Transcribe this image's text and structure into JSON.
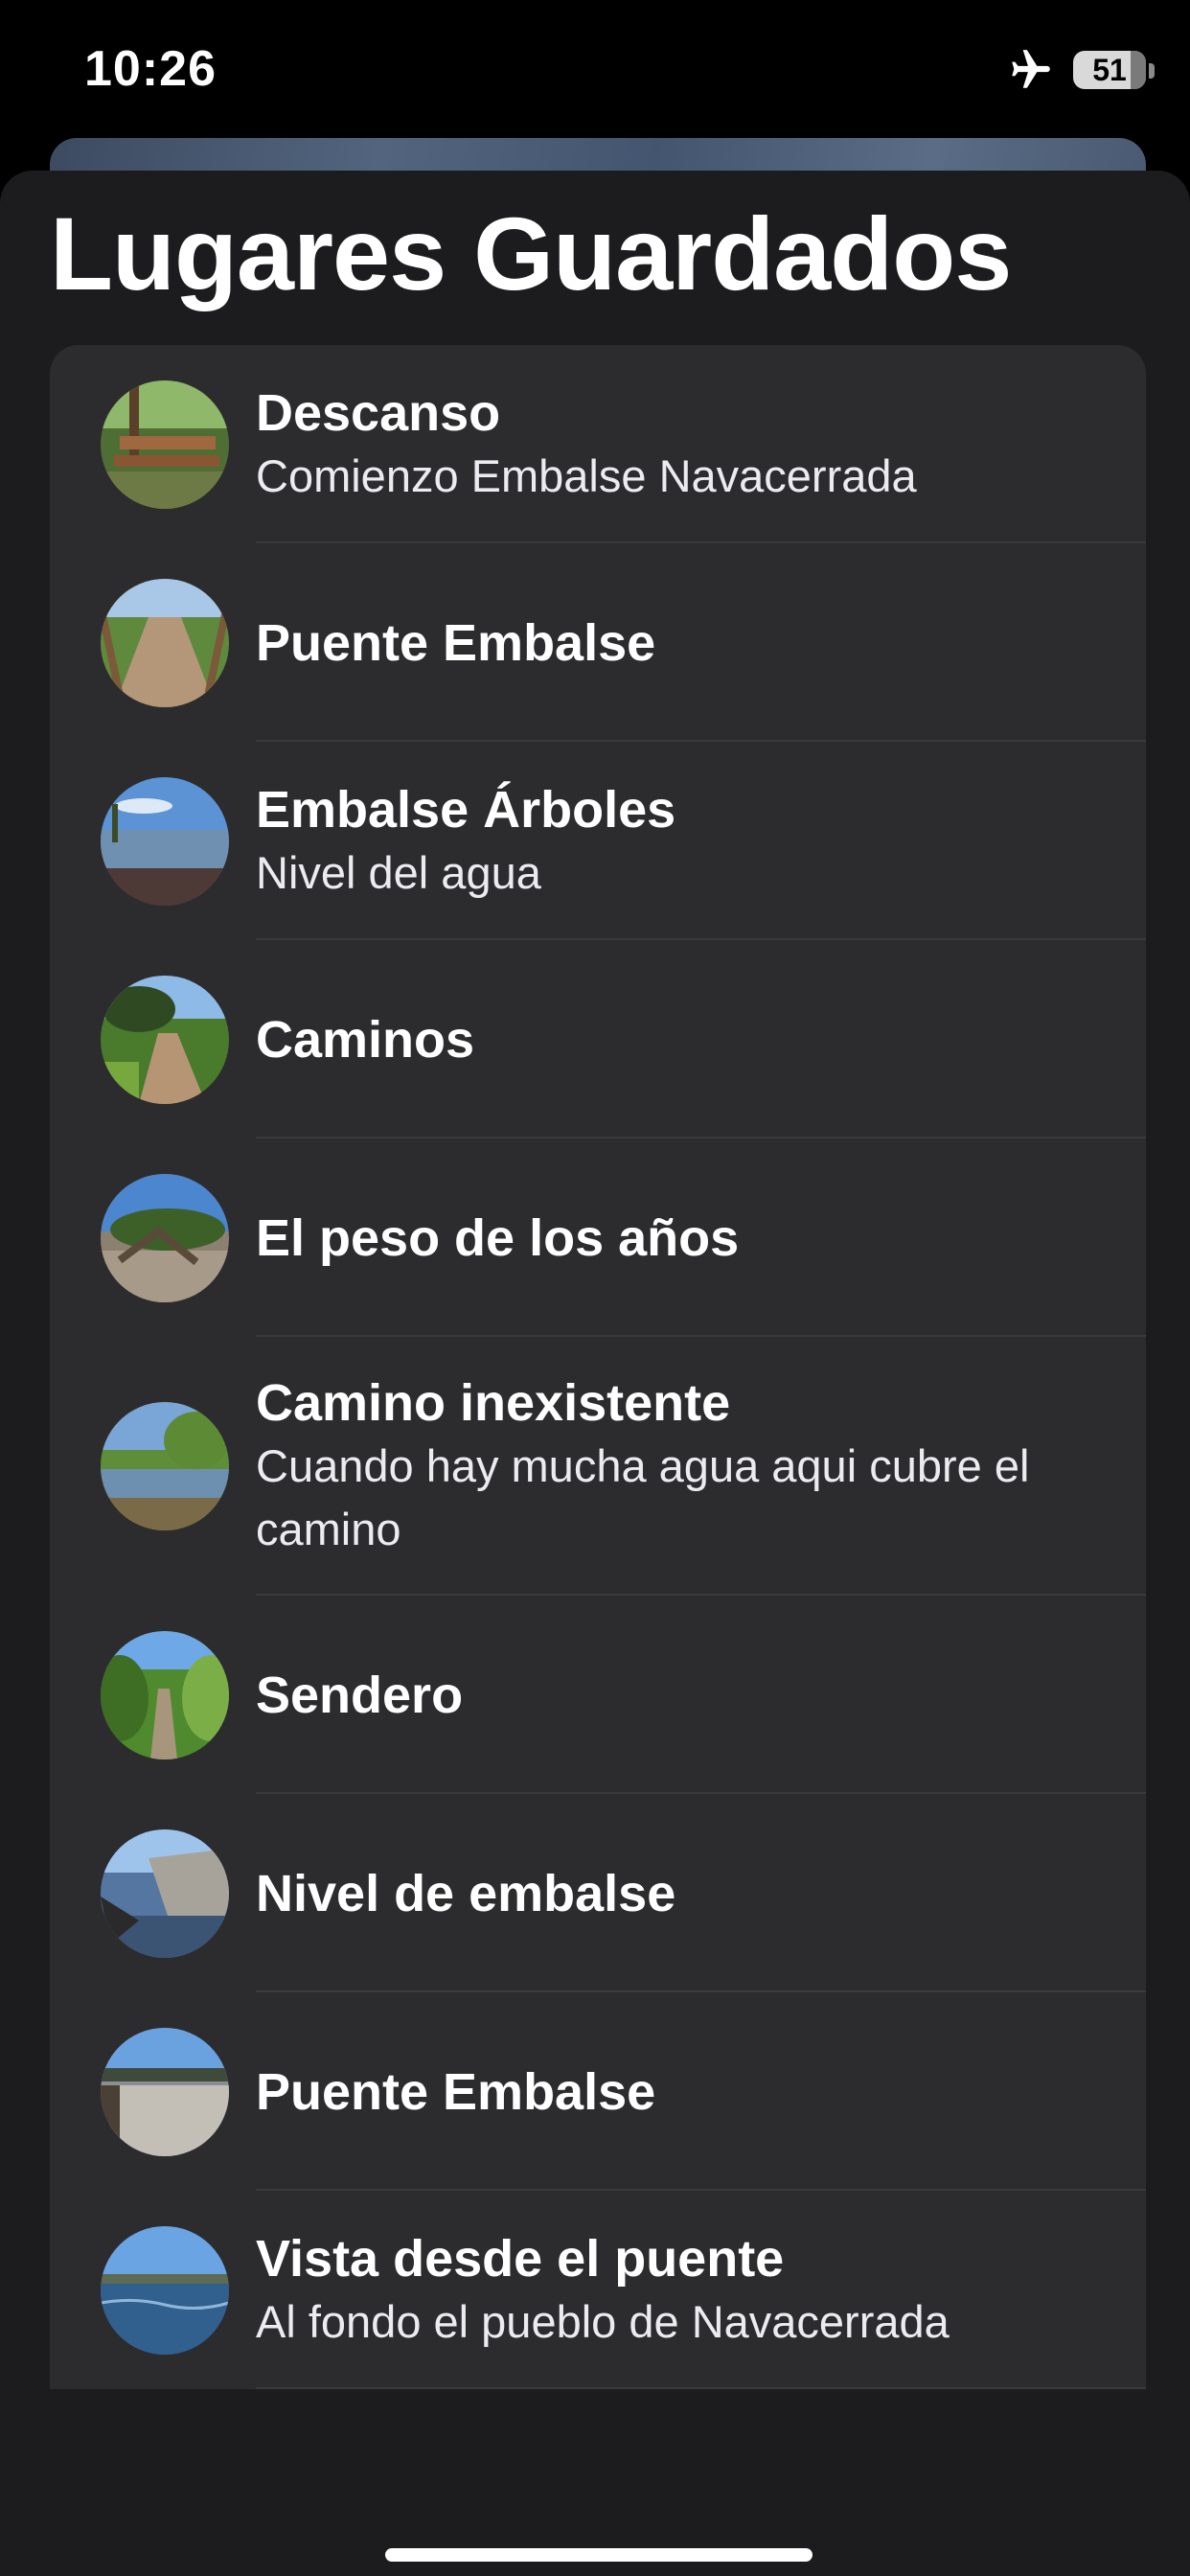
{
  "status_bar": {
    "time": "10:26",
    "battery": "51"
  },
  "title": "Lugares Guardados",
  "places": [
    {
      "title": "Descanso",
      "subtitle": "Comienzo Embalse Navacerrada",
      "thumb": "picnic-table-photo"
    },
    {
      "title": "Puente Embalse",
      "subtitle": "",
      "thumb": "wooden-bridge-photo"
    },
    {
      "title": "Embalse Árboles",
      "subtitle": "Nivel del agua",
      "thumb": "reservoir-trees-photo"
    },
    {
      "title": "Caminos",
      "subtitle": "",
      "thumb": "dirt-path-photo"
    },
    {
      "title": "El peso de los años",
      "subtitle": "",
      "thumb": "old-tree-photo"
    },
    {
      "title": "Camino inexistente",
      "subtitle": "Cuando hay mucha agua aqui cubre el camino",
      "thumb": "flooded-path-photo"
    },
    {
      "title": "Sendero",
      "subtitle": "",
      "thumb": "trail-photo"
    },
    {
      "title": "Nivel de embalse",
      "subtitle": "",
      "thumb": "reservoir-rocks-photo"
    },
    {
      "title": "Puente Embalse",
      "subtitle": "",
      "thumb": "stone-bridge-photo"
    },
    {
      "title": "Vista desde el puente",
      "subtitle": "Al fondo el pueblo de Navacerrada",
      "thumb": "lake-view-photo"
    }
  ]
}
